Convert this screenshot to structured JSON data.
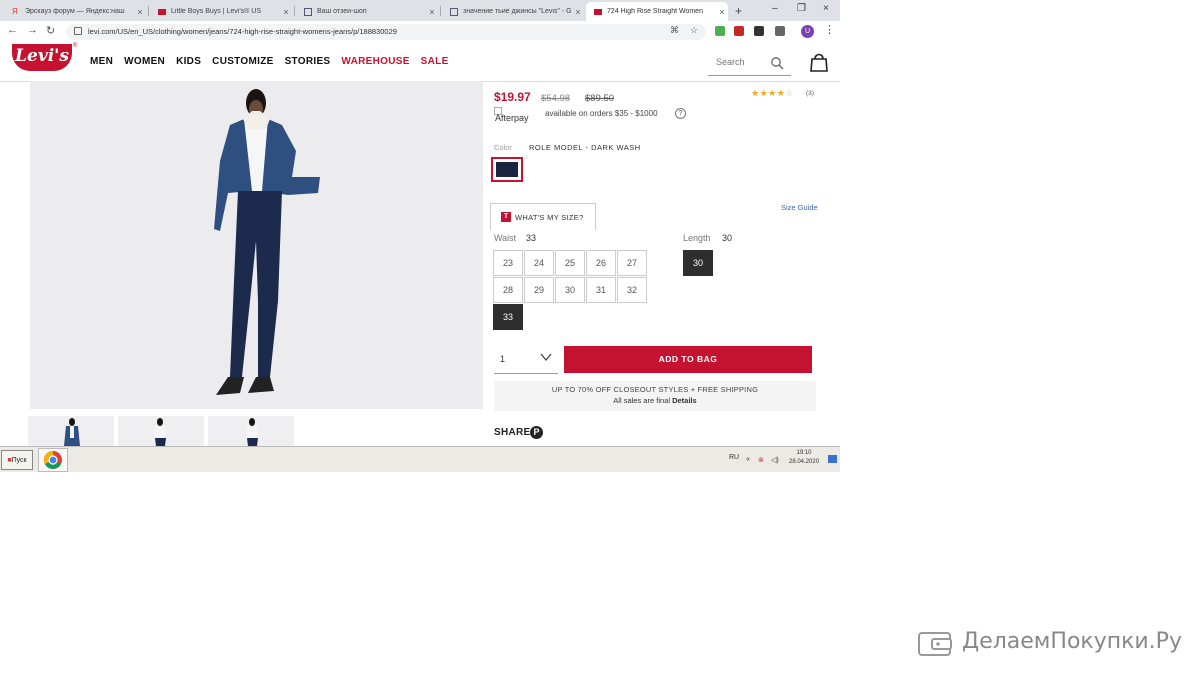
{
  "browser": {
    "tabs": [
      {
        "title": "Эрскауз форум — Яндекс:наш"
      },
      {
        "title": "Little Boys Buys | Levi's® US"
      },
      {
        "title": "Ваш отзеи-шоп"
      },
      {
        "title": "значение тьие джинсы \"Levis\" - G"
      },
      {
        "title": "724 High Rise Straight Women"
      }
    ],
    "url": "levi.com/US/en_US/clothing/women/jeans/724-high-rise-straight-womens-jeans/p/188830029"
  },
  "site": {
    "logo": "Levi's",
    "nav": [
      "MEN",
      "WOMEN",
      "KIDS",
      "CUSTOMIZE",
      "STORIES",
      "WAREHOUSE",
      "SALE"
    ],
    "search_placeholder": "Search"
  },
  "product": {
    "price_sale": "$19.97",
    "price_was1": "$54.98",
    "price_was2": "$89.50",
    "rating": 4,
    "review_count": "(3)",
    "afterpay_alt": "Afterpay",
    "afterpay_text": "available on orders $35 - $1000",
    "color_label": "Color",
    "color_value": "ROLE MODEL - DARK WASH",
    "swatch_color": "#1b2540",
    "whats_my_size": "WHAT'S MY SIZE?",
    "size_guide": "Size Guide",
    "waist_label": "Waist",
    "waist_value": "33",
    "length_label": "Length",
    "length_value": "30",
    "waist_sizes": [
      "23",
      "24",
      "25",
      "26",
      "27",
      "28",
      "29",
      "30",
      "31",
      "32",
      "33"
    ],
    "length_sizes": [
      "30"
    ],
    "quantity": "1",
    "add_to_bag": "ADD TO BAG",
    "promo_line1": "UP TO 70% OFF CLOSEOUT STYLES + FREE SHIPPING",
    "promo_line2": "All sales are final",
    "promo_link": "Details",
    "share": "SHARE"
  },
  "taskbar": {
    "start": "Пуск",
    "lang": "RU",
    "time": "19:10",
    "date": "28.04.2020"
  },
  "watermark": "ДелаемПокупки.Ру",
  "colors": {
    "brand": "#c41230",
    "selected": "#2e2e2e",
    "link": "#3a6aa5"
  }
}
